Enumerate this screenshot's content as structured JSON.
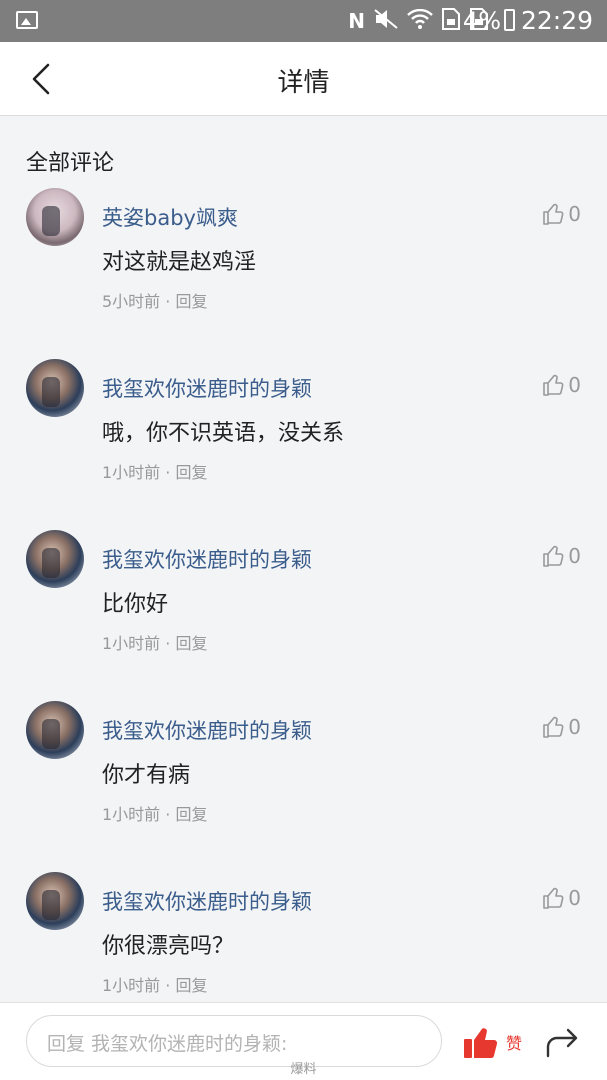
{
  "status_bar": {
    "battery": "4%",
    "time": "22:29"
  },
  "header": {
    "title": "详情"
  },
  "section": {
    "title": "全部评论"
  },
  "comments": [
    {
      "user": "英姿baby飒爽",
      "text": "对这就是赵鸡淫",
      "time": "5小时前",
      "reply": "回复",
      "likes": "0"
    },
    {
      "user": "我玺欢你迷鹿时的身颖",
      "text": "哦，你不识英语，没关系",
      "time": "1小时前",
      "reply": "回复",
      "likes": "0"
    },
    {
      "user": "我玺欢你迷鹿时的身颖",
      "text": "比你好",
      "time": "1小时前",
      "reply": "回复",
      "likes": "0"
    },
    {
      "user": "我玺欢你迷鹿时的身颖",
      "text": "你才有病",
      "time": "1小时前",
      "reply": "回复",
      "likes": "0"
    },
    {
      "user": "我玺欢你迷鹿时的身颖",
      "text": "你很漂亮吗？",
      "time": "1小时前",
      "reply": "回复",
      "likes": "0"
    }
  ],
  "bottom_bar": {
    "reply_placeholder": "回复 我玺欢你迷鹿时的身颖:",
    "like_label": "赞"
  },
  "watermark": "爆料",
  "colors": {
    "username": "#3b5d8c",
    "like_active": "#e7382f",
    "status_bar_bg": "#7e7e7e"
  }
}
